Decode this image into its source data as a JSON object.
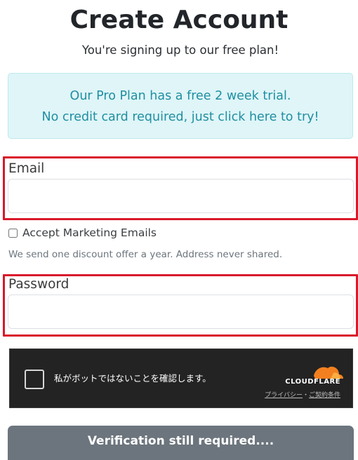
{
  "header": {
    "title": "Create Account",
    "subtitle": "You're signing up to our free plan!"
  },
  "promo": {
    "line1": "Our Pro Plan has a free 2 week trial.",
    "line2": "No credit card required, just click here to try!"
  },
  "email": {
    "label": "Email",
    "value": "",
    "placeholder": ""
  },
  "marketing": {
    "label": "Accept Marketing Emails",
    "checked": false,
    "hint": "We send one discount offer a year. Address never shared."
  },
  "password": {
    "label": "Password",
    "value": "",
    "placeholder": ""
  },
  "captcha": {
    "label": "私がボットではないことを確認します。",
    "brand": "CLOUDFLARE",
    "privacy_link": "プライバシー",
    "separator": "・",
    "terms_link": "ご契約条件",
    "icon": "cloud-icon",
    "brand_color": "#f38020"
  },
  "submit": {
    "label": "Verification still required...."
  },
  "colors": {
    "highlight": "#d9182b",
    "promo_text": "#1f8fa1",
    "promo_bg": "#dff5f8",
    "button_bg": "#6c757d"
  }
}
